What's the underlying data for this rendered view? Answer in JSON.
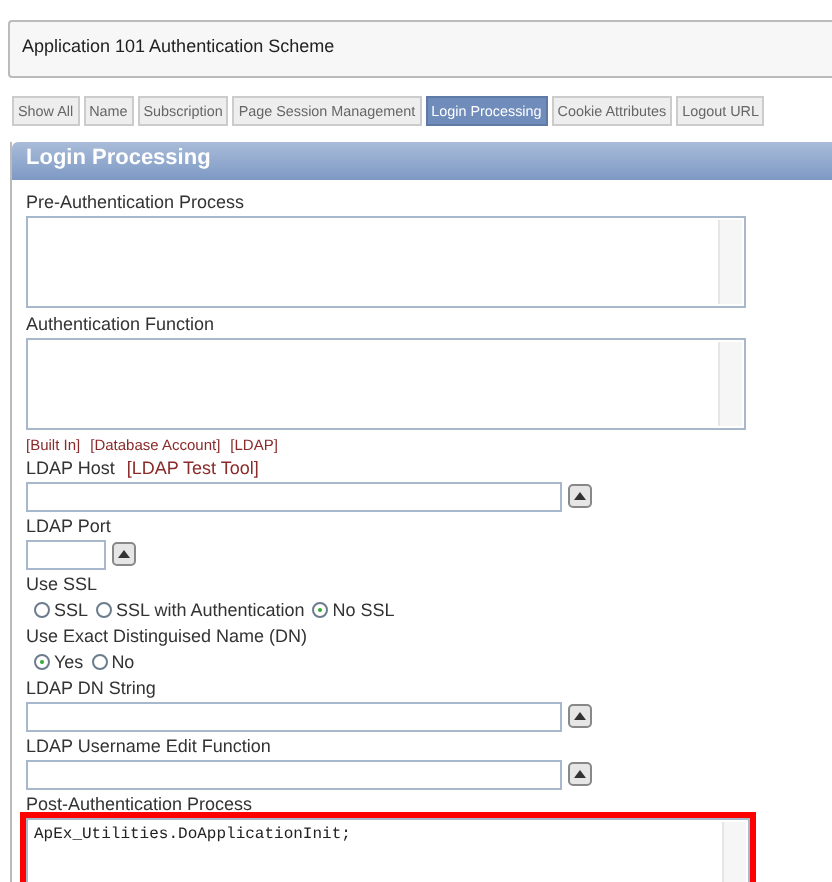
{
  "header": {
    "title": "Application 101 Authentication Scheme"
  },
  "tabs": [
    {
      "label": "Show All",
      "selected": false
    },
    {
      "label": "Name",
      "selected": false
    },
    {
      "label": "Subscription",
      "selected": false
    },
    {
      "label": "Page Session Management",
      "selected": false
    },
    {
      "label": "Login Processing",
      "selected": true
    },
    {
      "label": "Cookie Attributes",
      "selected": false
    },
    {
      "label": "Logout URL",
      "selected": false
    }
  ],
  "region": {
    "title": "Login Processing",
    "fields": [
      {
        "kind": "textarea",
        "label": "Pre-Authentication Process"
      },
      {
        "kind": "textarea",
        "label": "Authentication Function",
        "links": [
          "[Built In]",
          "[Database Account]",
          "[LDAP]"
        ]
      },
      {
        "kind": "text",
        "label": "LDAP Host",
        "label_link": "[LDAP Test Tool]"
      },
      {
        "kind": "short_text",
        "label": "LDAP Port"
      },
      {
        "kind": "radio",
        "label": "Use SSL",
        "options": [
          {
            "label": "SSL",
            "selected": false
          },
          {
            "label": "SSL with Authentication",
            "selected": false
          },
          {
            "label": "No SSL",
            "selected": true
          }
        ]
      },
      {
        "kind": "radio",
        "label": "Use Exact Distinguised Name (DN)",
        "options": [
          {
            "label": "Yes",
            "selected": true
          },
          {
            "label": "No",
            "selected": false
          }
        ]
      },
      {
        "kind": "text",
        "label": "LDAP DN String"
      },
      {
        "kind": "text",
        "label": "LDAP Username Edit Function"
      },
      {
        "kind": "textarea",
        "label": "Post-Authentication Process",
        "value": "ApEx_Utilities.DoApplicationInit;",
        "highlighted": true
      }
    ]
  }
}
